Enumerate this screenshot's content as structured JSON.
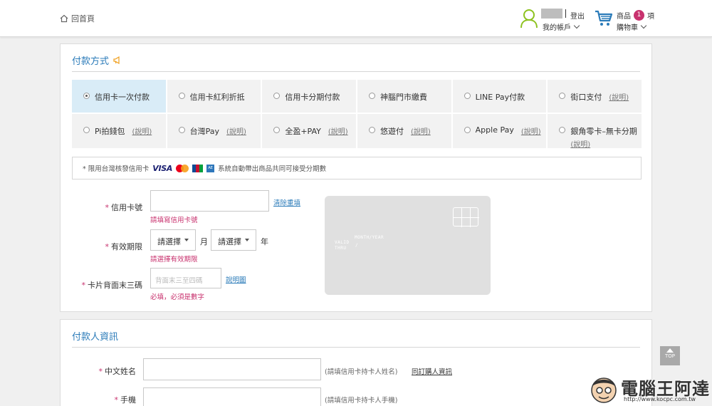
{
  "header": {
    "home_label": "回首頁",
    "logout_label": "登出",
    "account_label": "我的帳戶",
    "cart_label_top": "商品",
    "cart_count": "1",
    "cart_unit": "項",
    "cart_label_bottom": "購物車"
  },
  "payment": {
    "title": "付款方式",
    "options": [
      {
        "label": "信用卡一次付款",
        "explain": "",
        "selected": true
      },
      {
        "label": "信用卡紅利折抵",
        "explain": ""
      },
      {
        "label": "信用卡分期付款",
        "explain": ""
      },
      {
        "label": "神腦門市繳費",
        "explain": ""
      },
      {
        "label": "LINE Pay付款",
        "explain": ""
      },
      {
        "label": "街口支付",
        "explain": "(說明)"
      },
      {
        "label": "Pi拍錢包",
        "explain": "(說明)"
      },
      {
        "label": "台灣Pay",
        "explain": "(說明)"
      },
      {
        "label": "全盈+PAY",
        "explain": "(說明)"
      },
      {
        "label": "悠遊付",
        "explain": "(說明)"
      },
      {
        "label": "Apple Pay",
        "explain": "(說明)"
      },
      {
        "label": "銀角零卡–無卡分期",
        "explain": "(說明)"
      }
    ],
    "notice_prefix": "* 限用台灣核發信用卡",
    "notice_visa": "VISA",
    "notice_suffix": "系統自動帶出商品共同可接受分期數"
  },
  "card_form": {
    "card_number_label": "信用卡號",
    "clear_link": "清除重填",
    "card_number_error": "請填寫信用卡號",
    "expiry_label": "有效期限",
    "month_select": "請選擇",
    "month_unit": "月",
    "year_select": "請選擇",
    "year_unit": "年",
    "expiry_error": "請選擇有效期限",
    "cvv_label": "卡片背面末三碼",
    "cvv_placeholder": "背面末三至四碼",
    "cvv_help_link": "說明圖",
    "cvv_error": "必填，必須是數字",
    "card_graphic": {
      "valid_thru": "VALID\nTHRU",
      "month_year": "MONTH/YEAR",
      "slash": "/"
    }
  },
  "payer": {
    "title": "付款人資訊",
    "name_label": "中文姓名",
    "name_hint": "(請填信用卡持卡人姓名)",
    "same_as_buyer_link": "同訂購人資訊",
    "phone_label": "手機",
    "phone_hint": "(請填信用卡持卡人手機)"
  },
  "top_button": "TOP",
  "watermark": {
    "text": "電腦王阿達",
    "url": "http://www.kocpc.com.tw"
  },
  "colors": {
    "accent": "#2b7bb9",
    "error": "#c8326e",
    "selected_bg": "#d9ecf7",
    "user_icon": "#8dc21f",
    "cart_icon": "#2b7bb9"
  }
}
